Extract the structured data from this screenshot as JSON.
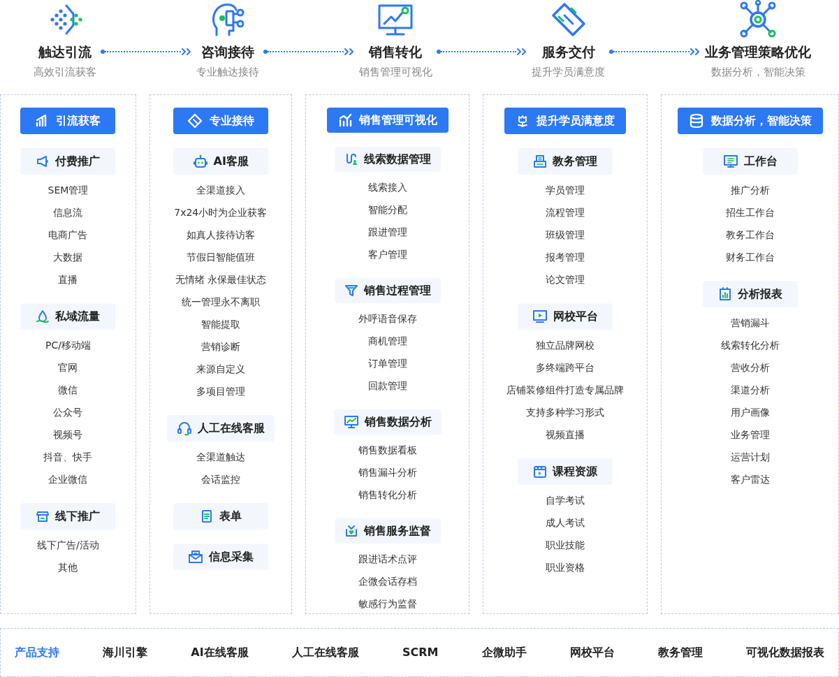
{
  "stages": [
    {
      "title": "触达引流",
      "subtitle": "高效引流获客"
    },
    {
      "title": "咨询接待",
      "subtitle": "专业触达接待"
    },
    {
      "title": "销售转化",
      "subtitle": "销售管理可视化"
    },
    {
      "title": "服务交付",
      "subtitle": "提升学员满意度"
    },
    {
      "title": "业务管理策略优化",
      "subtitle": "数据分析，智能决策"
    }
  ],
  "columns": [
    {
      "header": "引流获客",
      "groups": [
        {
          "title": "付费推广",
          "items": [
            "SEM管理",
            "信息流",
            "电商广告",
            "大数据",
            "直播"
          ]
        },
        {
          "title": "私域流量",
          "items": [
            "PC/移动端",
            "官网",
            "微信",
            "公众号",
            "视频号",
            "抖音、快手",
            "企业微信"
          ]
        },
        {
          "title": "线下推广",
          "items": [
            "线下广告/活动",
            "其他"
          ]
        }
      ]
    },
    {
      "header": "专业接待",
      "groups": [
        {
          "title": "AI客服",
          "items": [
            "全渠道接入",
            "7x24小时为企业获客",
            "如真人接待访客",
            "节假日智能值班",
            "无情绪 永保最佳状态",
            "统一管理永不离职",
            "智能提取",
            "营销诊断",
            "来源自定义",
            "多项目管理"
          ]
        },
        {
          "title": "人工在线客服",
          "items": [
            "全渠道触达",
            "会话监控"
          ]
        },
        {
          "title": "表单"
        },
        {
          "title": "信息采集"
        }
      ]
    },
    {
      "header": "销售管理可视化",
      "groups": [
        {
          "title": "线索数据管理",
          "items": [
            "线索接入",
            "智能分配",
            "跟进管理",
            "客户管理"
          ]
        },
        {
          "title": "销售过程管理",
          "items": [
            "外呼语音保存",
            "商机管理",
            "订单管理",
            "回款管理"
          ]
        },
        {
          "title": "销售数据分析",
          "items": [
            "销售数据看板",
            "销售漏斗分析",
            "销售转化分析"
          ]
        },
        {
          "title": "销售服务监督",
          "items": [
            "跟进话术点评",
            "企微会话存档",
            "敏感行为监督"
          ]
        }
      ]
    },
    {
      "header": "提升学员满意度",
      "groups": [
        {
          "title": "教务管理",
          "items": [
            "学员管理",
            "流程管理",
            "班级管理",
            "报考管理",
            "论文管理"
          ]
        },
        {
          "title": "网校平台",
          "items": [
            "独立品牌网校",
            "多终端跨平台",
            "店铺装修组件打造专属品牌",
            "支持多种学习形式",
            "视频直播"
          ]
        },
        {
          "title": "课程资源",
          "items": [
            "自学考试",
            "成人考试",
            "职业技能",
            "职业资格"
          ]
        }
      ]
    },
    {
      "header": "数据分析，智能决策",
      "groups": [
        {
          "title": "工作台",
          "items": [
            "推广分析",
            "招生工作台",
            "教务工作台",
            "财务工作台"
          ]
        },
        {
          "title": "分析报表",
          "items": [
            "营销漏斗",
            "线索转化分析",
            "营收分析",
            "渠道分析",
            "用户画像",
            "业务管理",
            "运营计划",
            "客户雷达"
          ]
        }
      ]
    }
  ],
  "product_support": {
    "label": "产品支持",
    "items": [
      "海川引擎",
      "AI在线客服",
      "人工在线客服",
      "SCRM",
      "企微助手",
      "网校平台",
      "教务管理",
      "可视化数据报表"
    ]
  }
}
